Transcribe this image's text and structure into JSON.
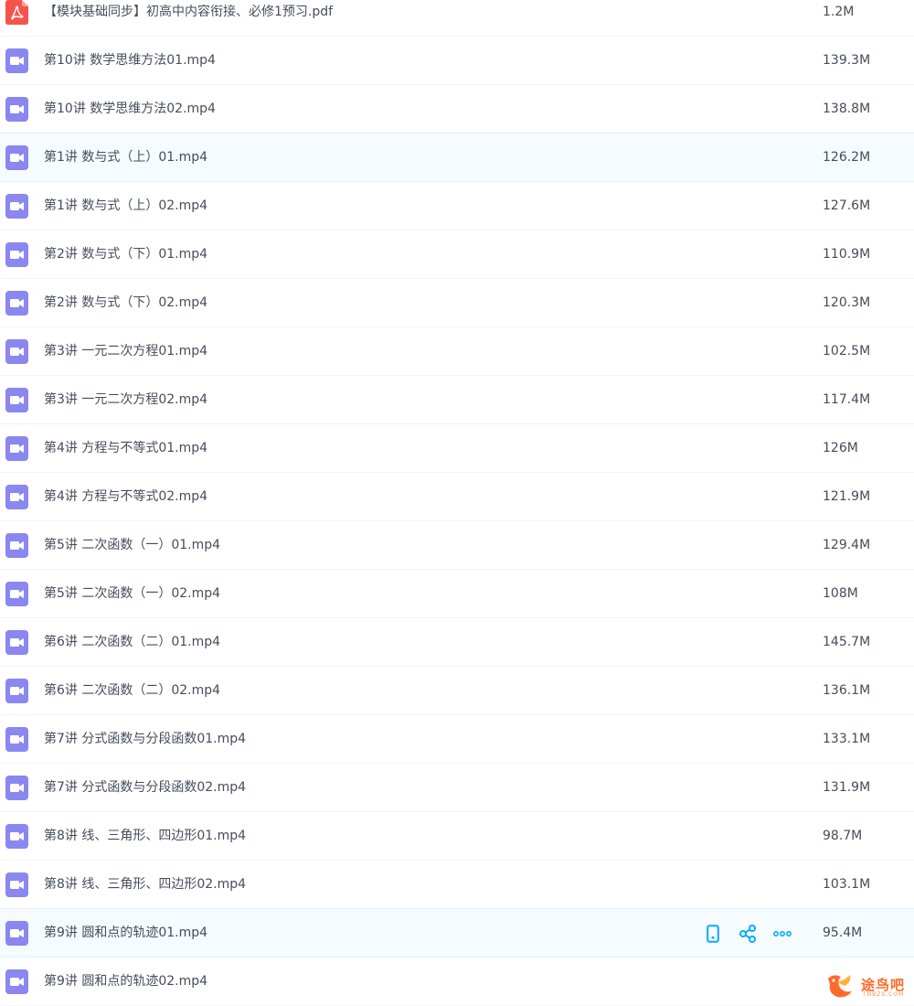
{
  "files": [
    {
      "name": "【模块基础同步】初高中内容衔接、必修1预习.pdf",
      "size": "1.2M",
      "type": "pdf",
      "icon": "pdf-file-icon"
    },
    {
      "name": "第10讲 数学思维方法01.mp4",
      "size": "139.3M",
      "type": "video",
      "icon": "video-file-icon"
    },
    {
      "name": "第10讲 数学思维方法02.mp4",
      "size": "138.8M",
      "type": "video",
      "icon": "video-file-icon"
    },
    {
      "name": "第1讲 数与式（上）01.mp4",
      "size": "126.2M",
      "type": "video",
      "icon": "video-file-icon"
    },
    {
      "name": "第1讲 数与式（上）02.mp4",
      "size": "127.6M",
      "type": "video",
      "icon": "video-file-icon"
    },
    {
      "name": "第2讲 数与式（下）01.mp4",
      "size": "110.9M",
      "type": "video",
      "icon": "video-file-icon"
    },
    {
      "name": "第2讲 数与式（下）02.mp4",
      "size": "120.3M",
      "type": "video",
      "icon": "video-file-icon"
    },
    {
      "name": "第3讲 一元二次方程01.mp4",
      "size": "102.5M",
      "type": "video",
      "icon": "video-file-icon"
    },
    {
      "name": "第3讲 一元二次方程02.mp4",
      "size": "117.4M",
      "type": "video",
      "icon": "video-file-icon"
    },
    {
      "name": "第4讲 方程与不等式01.mp4",
      "size": "126M",
      "type": "video",
      "icon": "video-file-icon"
    },
    {
      "name": "第4讲 方程与不等式02.mp4",
      "size": "121.9M",
      "type": "video",
      "icon": "video-file-icon"
    },
    {
      "name": "第5讲 二次函数（一）01.mp4",
      "size": "129.4M",
      "type": "video",
      "icon": "video-file-icon"
    },
    {
      "name": "第5讲 二次函数（一）02.mp4",
      "size": "108M",
      "type": "video",
      "icon": "video-file-icon"
    },
    {
      "name": "第6讲 二次函数（二）01.mp4",
      "size": "145.7M",
      "type": "video",
      "icon": "video-file-icon"
    },
    {
      "name": "第6讲 二次函数（二）02.mp4",
      "size": "136.1M",
      "type": "video",
      "icon": "video-file-icon"
    },
    {
      "name": "第7讲 分式函数与分段函数01.mp4",
      "size": "133.1M",
      "type": "video",
      "icon": "video-file-icon"
    },
    {
      "name": "第7讲 分式函数与分段函数02.mp4",
      "size": "131.9M",
      "type": "video",
      "icon": "video-file-icon"
    },
    {
      "name": "第8讲 线、三角形、四边形01.mp4",
      "size": "98.7M",
      "type": "video",
      "icon": "video-file-icon"
    },
    {
      "name": "第8讲 线、三角形、四边形02.mp4",
      "size": "103.1M",
      "type": "video",
      "icon": "video-file-icon"
    },
    {
      "name": "第9讲 圆和点的轨迹01.mp4",
      "size": "95.4M",
      "type": "video",
      "icon": "video-file-icon",
      "hovered": true
    },
    {
      "name": "第9讲 圆和点的轨迹02.mp4",
      "size": "",
      "type": "video",
      "icon": "video-file-icon"
    }
  ],
  "highlighted_rows": [
    3,
    19
  ],
  "row_actions": [
    {
      "icon": "phone-icon",
      "name": "send-to-phone-button"
    },
    {
      "icon": "share-icon",
      "name": "share-button"
    },
    {
      "icon": "more-icon",
      "name": "more-button"
    }
  ],
  "watermark": {
    "text": "途鸟吧",
    "sub": "TNBZS.COM",
    "icon": "bird-logo-icon"
  },
  "colors": {
    "video_icon": "#8a87f0",
    "pdf_icon": "#f5544b",
    "action_blue": "#09aaff",
    "row_hover": "#f5fbff",
    "text": "#454d5a",
    "watermark": "#ff6a2a"
  }
}
